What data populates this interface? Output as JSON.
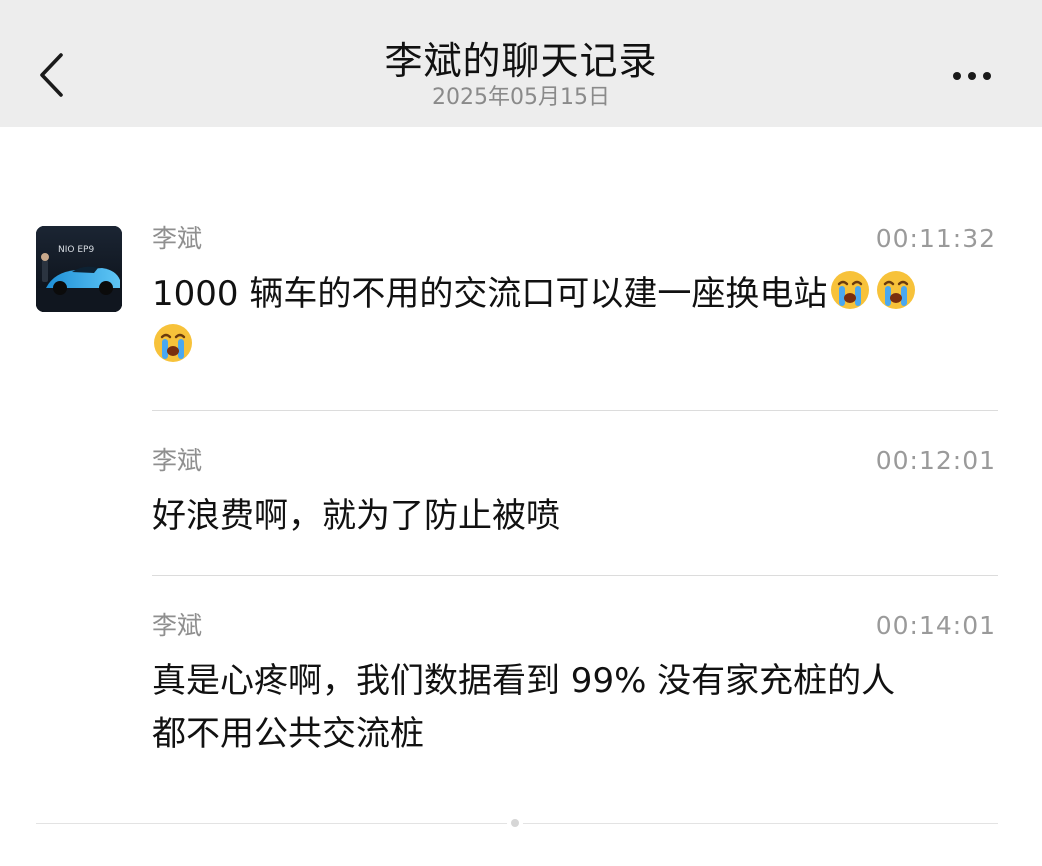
{
  "header": {
    "title": "李斌的聊天记录",
    "date": "2025年05月15日",
    "back_icon": "chevron-left-icon",
    "more_icon": "more-horizontal-icon"
  },
  "avatar": {
    "description_icon": "avatar",
    "logo_text": "NIO EP9"
  },
  "messages": [
    {
      "sender": "李斌",
      "time": "00:11:32",
      "text": "1000 辆车的不用的交流口可以建一座换电站",
      "emoji_count": 3,
      "emoji_icon": "crying-face-icon"
    },
    {
      "sender": "李斌",
      "time": "00:12:01",
      "text": "好浪费啊，就为了防止被喷"
    },
    {
      "sender": "李斌",
      "time": "00:14:01",
      "text_line1": "真是心疼啊，我们数据看到 99% 没有家充桩的人",
      "text_line2": "都不用公共交流桩"
    }
  ],
  "colors": {
    "header_bg": "#ededed",
    "title": "#111111",
    "meta": "#8f8f8f",
    "divider": "#dcdcdc"
  }
}
